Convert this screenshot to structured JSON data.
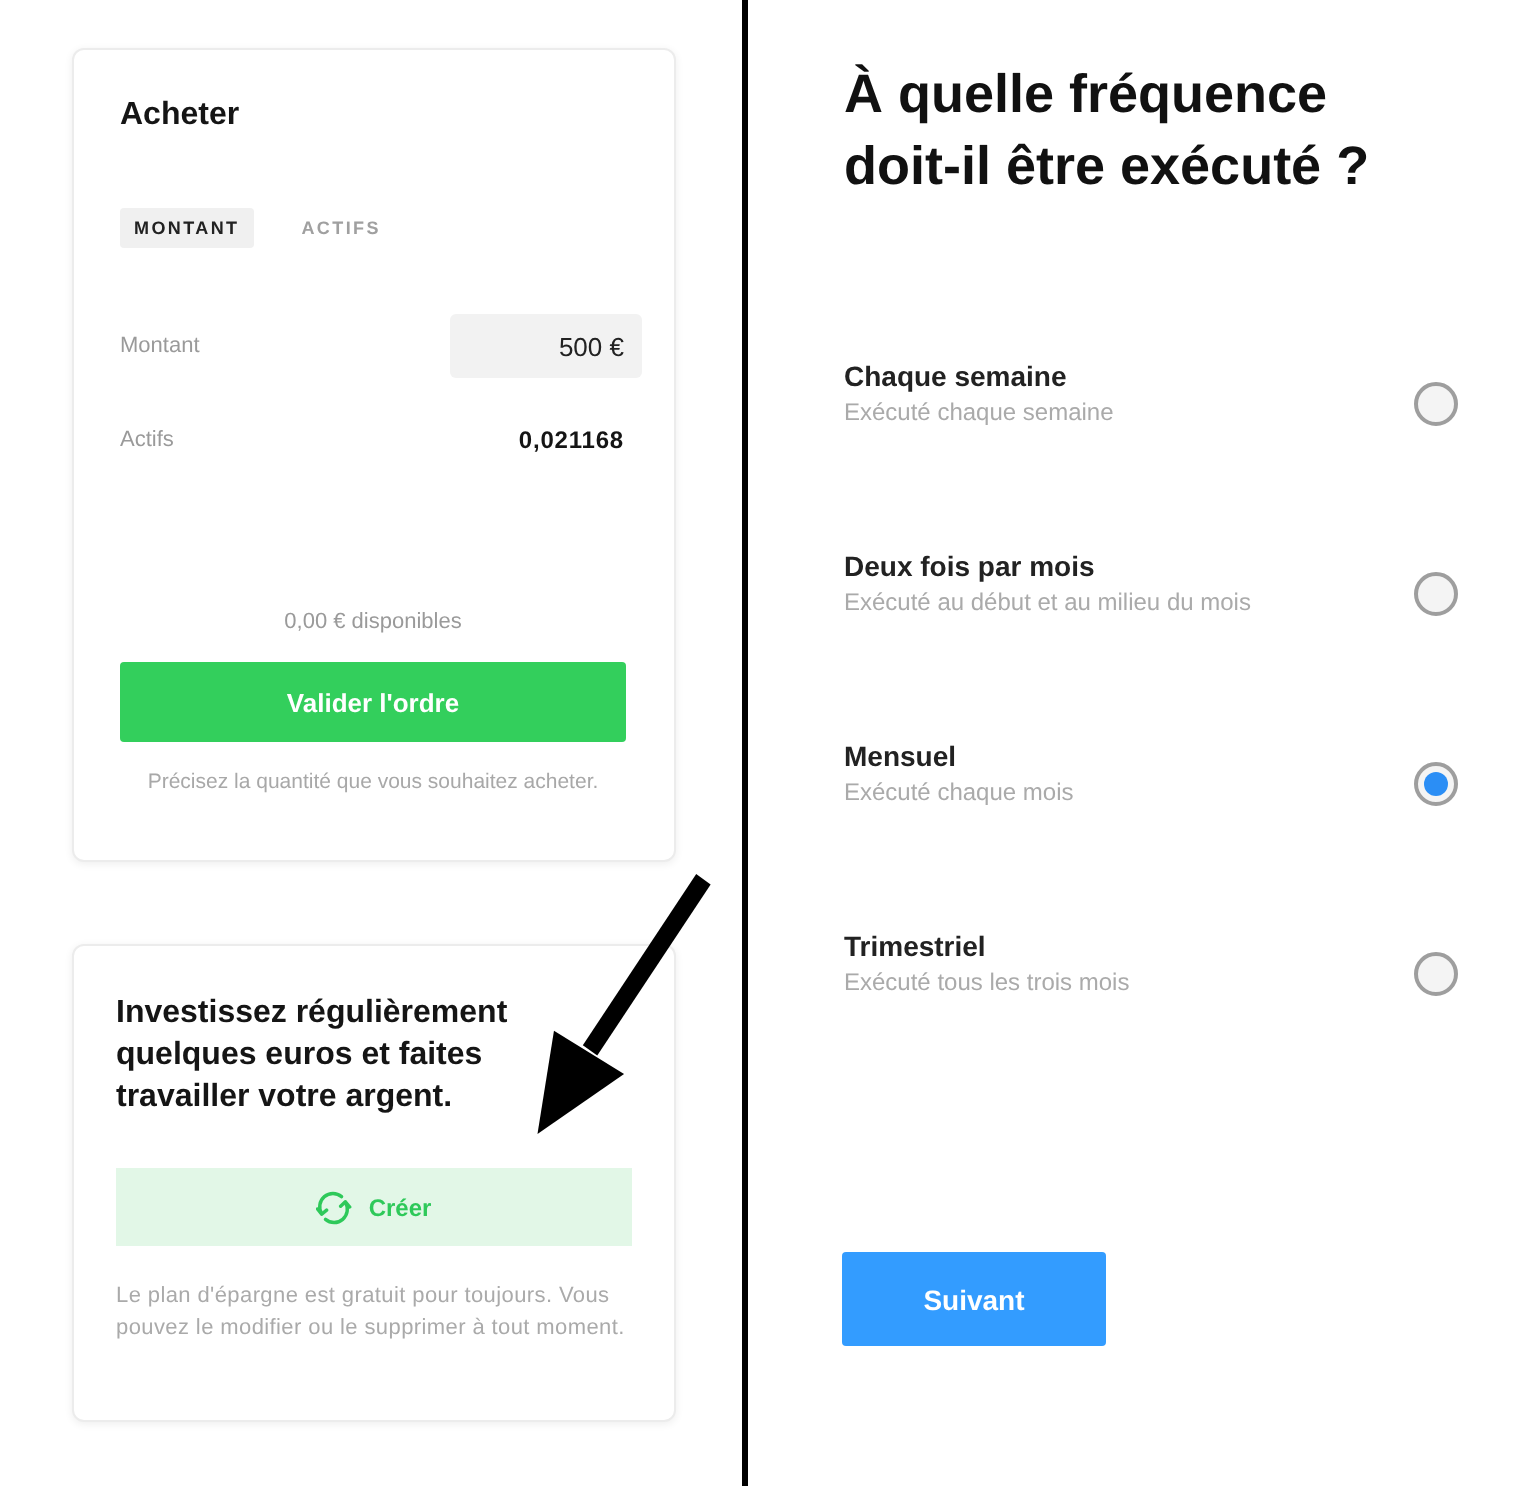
{
  "buy_card": {
    "title": "Acheter",
    "tabs": [
      {
        "label": "MONTANT",
        "selected": true
      },
      {
        "label": "ACTIFS",
        "selected": false
      }
    ],
    "fields": [
      {
        "kind": "input",
        "label": "Montant",
        "value": "500 €"
      },
      {
        "kind": "readout",
        "label": "Actifs",
        "value": "0,021168"
      }
    ],
    "available": "0,00 € disponibles",
    "submit_button": "Valider l'ordre",
    "hint": "Précisez la quantité que vous souhaitez acheter."
  },
  "savings_card": {
    "heading": "Investissez régulièrement quelques euros et faites travailler votre argent.",
    "create_button": "Créer",
    "note": "Le plan d'épargne est gratuit pour toujours. Vous pouvez le modifier ou le supprimer à tout moment."
  },
  "frequency": {
    "question": "À quelle fréquence doit-il être exécuté ?",
    "options": [
      {
        "title": "Chaque semaine",
        "description": "Exécuté chaque semaine",
        "selected": false
      },
      {
        "title": "Deux fois par mois",
        "description": "Exécuté au début et au milieu du mois",
        "selected": false
      },
      {
        "title": "Mensuel",
        "description": "Exécuté chaque mois",
        "selected": true
      },
      {
        "title": "Trimestriel",
        "description": "Exécuté tous les trois mois",
        "selected": false
      }
    ],
    "next_button": "Suivant"
  }
}
